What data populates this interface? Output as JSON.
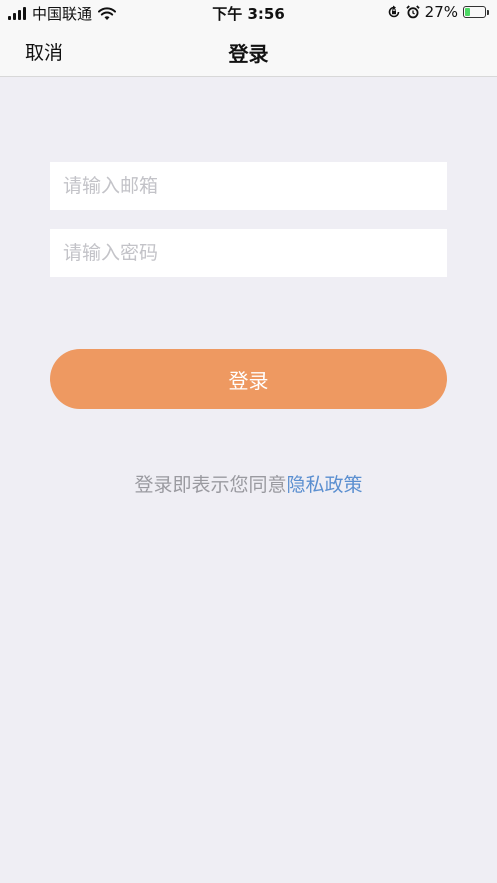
{
  "status_bar": {
    "carrier": "中国联通",
    "time": "下午 3:56",
    "battery_percent": "27%",
    "battery_level": 0.27,
    "icons": [
      "signal-icon",
      "wifi-icon",
      "orientation-lock-icon",
      "alarm-icon",
      "battery-icon"
    ]
  },
  "nav": {
    "cancel_label": "取消",
    "title": "登录"
  },
  "form": {
    "email": {
      "value": "",
      "placeholder": "请输入邮箱"
    },
    "password": {
      "value": "",
      "placeholder": "请输入密码"
    },
    "login_label": "登录"
  },
  "agreement": {
    "prefix": "登录即表示您同意",
    "link": "隐私政策"
  },
  "colors": {
    "background": "#efeef4",
    "bar": "#f8f8f8",
    "accent": "#ee9961",
    "link": "#5b8fd0",
    "muted_text": "#9a9aa0",
    "placeholder": "#c3c3c8"
  }
}
